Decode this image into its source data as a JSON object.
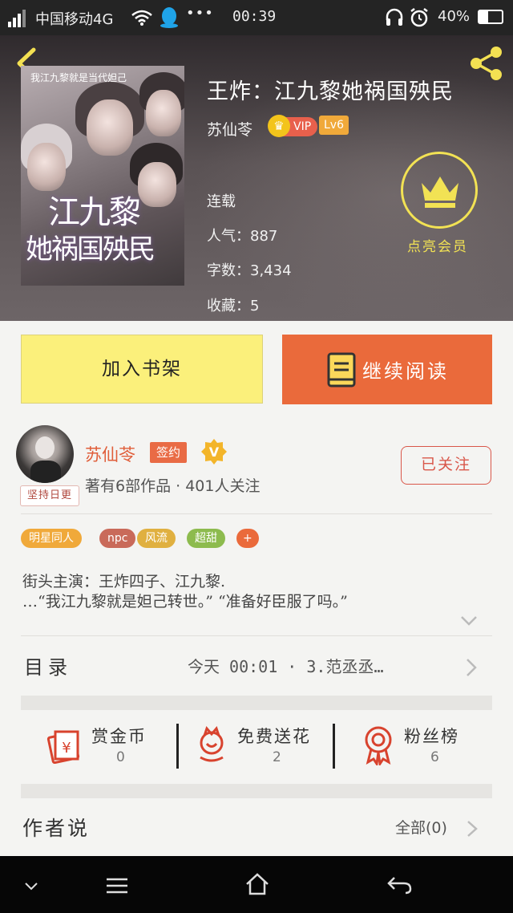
{
  "status_bar": {
    "carrier": "中国移动4G",
    "time": "00:39",
    "battery": "40%"
  },
  "book": {
    "title": "王炸：江九黎她祸国殃民",
    "author": "苏仙苓",
    "vip_label": "VIP",
    "level": "Lv6",
    "status": "连载",
    "popularity": "人气：887",
    "word_count": "字数：3,434",
    "favorites": "收藏：5",
    "cover_tagline": "我江九黎就是当代妲己",
    "cover_title_line1": "江九黎",
    "cover_title_line2": "她祸国殃民",
    "vip_light_label": "点亮会员"
  },
  "actions": {
    "add_shelf": "加入书架",
    "continue_read": "继续阅读"
  },
  "author_card": {
    "name": "苏仙苓",
    "signed": "签约",
    "verified": "V",
    "stats": "著有6部作品 · 401人关注",
    "follow": "已关注",
    "avatar_caption": "坚持日更"
  },
  "tags": [
    {
      "label": "明星同人",
      "color": "#f0a93a"
    },
    {
      "label": "npc",
      "color": "#c96a5a"
    },
    {
      "label": "风流",
      "color": "#e0b040"
    },
    {
      "label": "超甜",
      "color": "#8dbb4e"
    },
    {
      "label": "+",
      "color": "#ea6a3b"
    }
  ],
  "description": {
    "line1": "街头主演：王炸四子、江九黎.",
    "line2": "…“我江九黎就是妲己转世。” “准备好臣服了吗。”"
  },
  "toc": {
    "label": "目录",
    "latest": "今天 00:01 · 3.范丞丞…"
  },
  "stats": [
    {
      "label": "赏金币",
      "value": "0",
      "icon": "coin-envelope-icon"
    },
    {
      "label": "免费送花",
      "value": "2",
      "icon": "flower-icon"
    },
    {
      "label": "粉丝榜",
      "value": "6",
      "icon": "medal-icon"
    }
  ],
  "author_says": {
    "label": "作者说",
    "all": "全部(0)"
  },
  "colors": {
    "accent_orange": "#ea6a3b",
    "shelf_yellow": "#fbf07b",
    "vip_yellow": "#f2e254"
  }
}
